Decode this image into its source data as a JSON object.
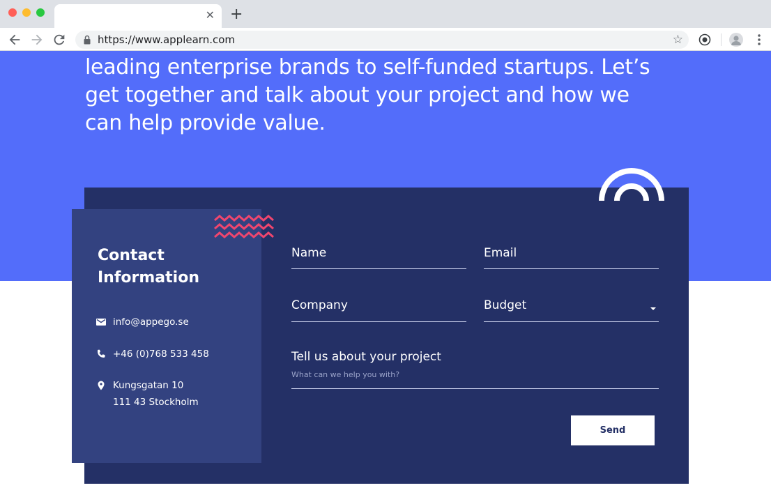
{
  "browser": {
    "url": "https://www.applearn.com",
    "new_tab_label": "+",
    "close_tab_label": "✕",
    "bookmark_label": "☆"
  },
  "hero": {
    "text": "leading enterprise brands to self-funded startups. Let’s get together and talk about your project and how we can help provide value."
  },
  "contact": {
    "title": "Contact Information",
    "email": "info@appego.se",
    "phone": "+46 (0)768 533 458",
    "address_line1": "Kungsgatan 10",
    "address_line2": "111 43 Stockholm"
  },
  "form": {
    "name_label": "Name",
    "email_label": "Email",
    "company_label": "Company",
    "budget_label": "Budget",
    "project_label": "Tell us about your project",
    "project_placeholder": "What can we help you with?",
    "send_label": "Send"
  },
  "colors": {
    "hero_bg": "#536dfa",
    "card_bg": "#243066",
    "info_bg": "#334280",
    "accent_zigzag": "#f0466e"
  }
}
